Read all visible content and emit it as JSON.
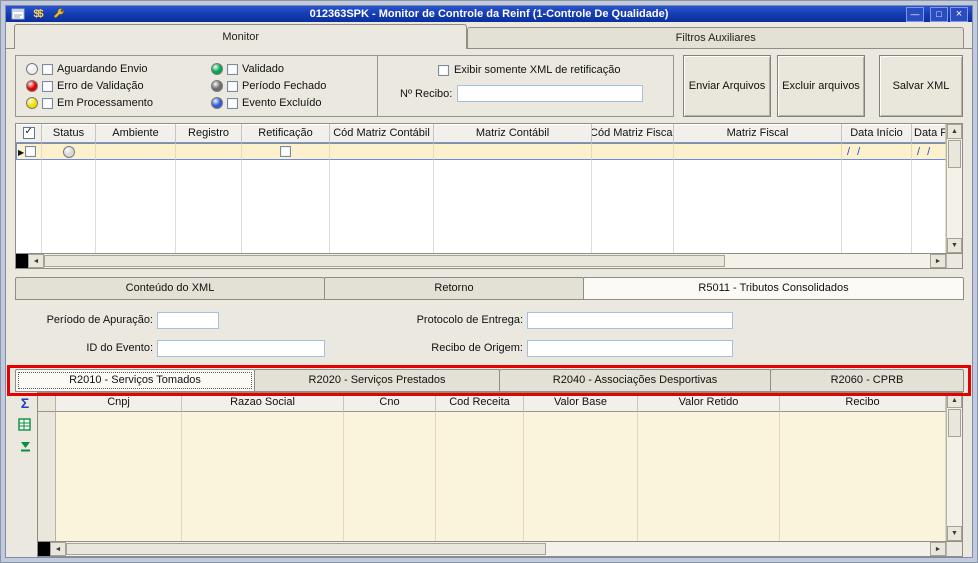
{
  "window": {
    "title": "012363SPK - Monitor de Controle da Reinf (1-Controle De Qualidade)"
  },
  "icons": {
    "titlebar": [
      "window-icon",
      "money-icon",
      "wrench-icon"
    ],
    "side_toolbar": [
      "sum-icon",
      "export-grid-icon",
      "go-last-icon"
    ],
    "controls": [
      "minimize-icon",
      "maximize-icon",
      "close-icon"
    ]
  },
  "top_tabs": {
    "monitor": "Monitor",
    "filtros": "Filtros Auxiliares"
  },
  "legend": {
    "col1": [
      {
        "label": "Aguardando Envio",
        "color": "#efefef"
      },
      {
        "label": "Erro de Validação",
        "color": "#e00000"
      },
      {
        "label": "Em Processamento",
        "color": "#f2df00"
      }
    ],
    "col2": [
      {
        "label": "Validado",
        "color": "#00a550"
      },
      {
        "label": "Período Fechado",
        "color": "#6d6d6d"
      },
      {
        "label": "Evento Excluído",
        "color": "#2e5bd8"
      }
    ]
  },
  "filters": {
    "xml_retificacao_label": "Exibir somente XML de retificação",
    "recibo_label": "Nº Recibo:",
    "recibo_value": ""
  },
  "action_buttons": {
    "enviar": "Enviar Arquivos",
    "excluir": "Excluir arquivos",
    "salvar": "Salvar XML"
  },
  "main_grid": {
    "columns": [
      "Status",
      "Ambiente",
      "Registro",
      "Retificação",
      "Cód Matriz Contábil",
      "Matriz Contábil",
      "Cód Matriz Fiscal",
      "Matriz Fiscal",
      "Data Início",
      "Data Fim"
    ],
    "row": {
      "status_color": "#d8d8d8",
      "data_inicio": "/  /",
      "data_fim": "/  /"
    }
  },
  "detail_tabs": {
    "conteudo": "Conteúdo do XML",
    "retorno": "Retorno",
    "r5011": "R5011 - Tributos Consolidados"
  },
  "detail_form": {
    "periodo_label": "Período de Apuração:",
    "periodo_value": "",
    "protocolo_label": "Protocolo de Entrega:",
    "protocolo_value": "",
    "id_evento_label": "ID do Evento:",
    "id_evento_value": "",
    "recibo_origem_label": "Recibo de Origem:",
    "recibo_origem_value": ""
  },
  "r_tabs": {
    "r2010": "R2010 - Serviços Tomados",
    "r2020": "R2020 - Serviços Prestados",
    "r2040": "R2040 - Associações Desportivas",
    "r2060": "R2060 - CPRB"
  },
  "bottom_grid": {
    "columns": [
      "Cnpj",
      "Razao Social",
      "Cno",
      "Cod Receita",
      "Valor Base",
      "Valor Retido",
      "Recibo"
    ]
  },
  "annotations": {
    "color": "#e60000",
    "targets": [
      "r5011-tab",
      "r2010-tabs-row"
    ]
  }
}
